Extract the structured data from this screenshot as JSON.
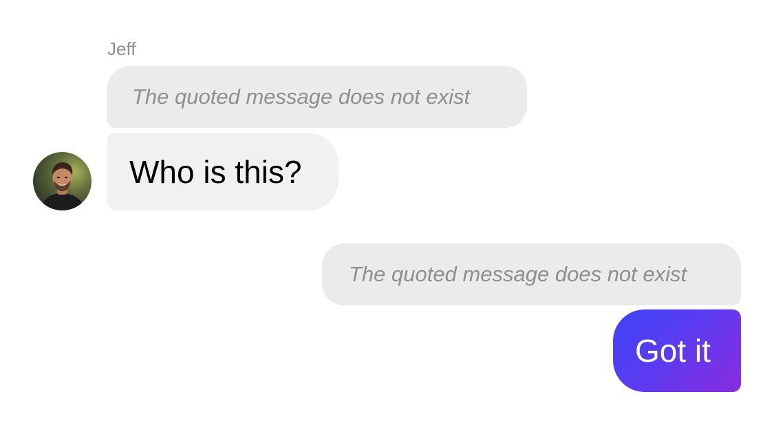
{
  "conversation": {
    "incoming": {
      "sender_name": "Jeff",
      "avatar_icon": "user-avatar-photo",
      "quoted_text": "The quoted message does not exist",
      "message_text": "Who is this?"
    },
    "outgoing": {
      "quoted_text": "The quoted message does not exist",
      "message_text": "Got it"
    }
  },
  "colors": {
    "incoming_bubble": "#f1f1f1",
    "quoted_bubble": "#ebebeb",
    "outgoing_gradient_start": "#3d45f5",
    "outgoing_gradient_end": "#8b2ce0",
    "secondary_text": "#8e8e93"
  }
}
